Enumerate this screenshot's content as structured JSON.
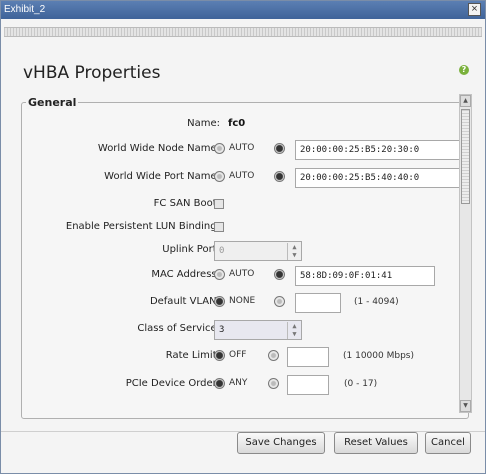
{
  "window": {
    "title": "Exhibit_2",
    "close_glyph": "×"
  },
  "heading": "vHBA Properties",
  "help_glyph": "?",
  "group_label": "General",
  "rows": {
    "name": {
      "label": "Name:",
      "value": "fc0"
    },
    "wwnn": {
      "label": "World Wide Node Name:",
      "auto": "AUTO",
      "value": "20:00:00:25:B5:20:30:0"
    },
    "wwpn": {
      "label": "World Wide Port Name:",
      "auto": "AUTO",
      "value": "20:00:00:25:B5:40:40:0"
    },
    "fc_san_boot": {
      "label": "FC SAN Boot:"
    },
    "persistent_lun": {
      "label": "Enable Persistent LUN Binding:"
    },
    "uplink": {
      "label": "Uplink Port:",
      "value": "0"
    },
    "mac": {
      "label": "MAC Address:",
      "auto": "AUTO",
      "value": "58:8D:09:0F:01:41"
    },
    "vlan": {
      "label": "Default VLAN:",
      "none": "NONE",
      "value": "",
      "range": "(1 - 4094)"
    },
    "cos": {
      "label": "Class of Service:",
      "value": "3"
    },
    "rate": {
      "label": "Rate Limit:",
      "off": "OFF",
      "value": "",
      "range": "(1  10000 Mbps)"
    },
    "pcie": {
      "label": "PCIe Device Order:",
      "any": "ANY",
      "value": "",
      "range": "(0 - 17)"
    }
  },
  "buttons": {
    "save": "Save Changes",
    "reset": "Reset Values",
    "cancel": "Cancel"
  }
}
